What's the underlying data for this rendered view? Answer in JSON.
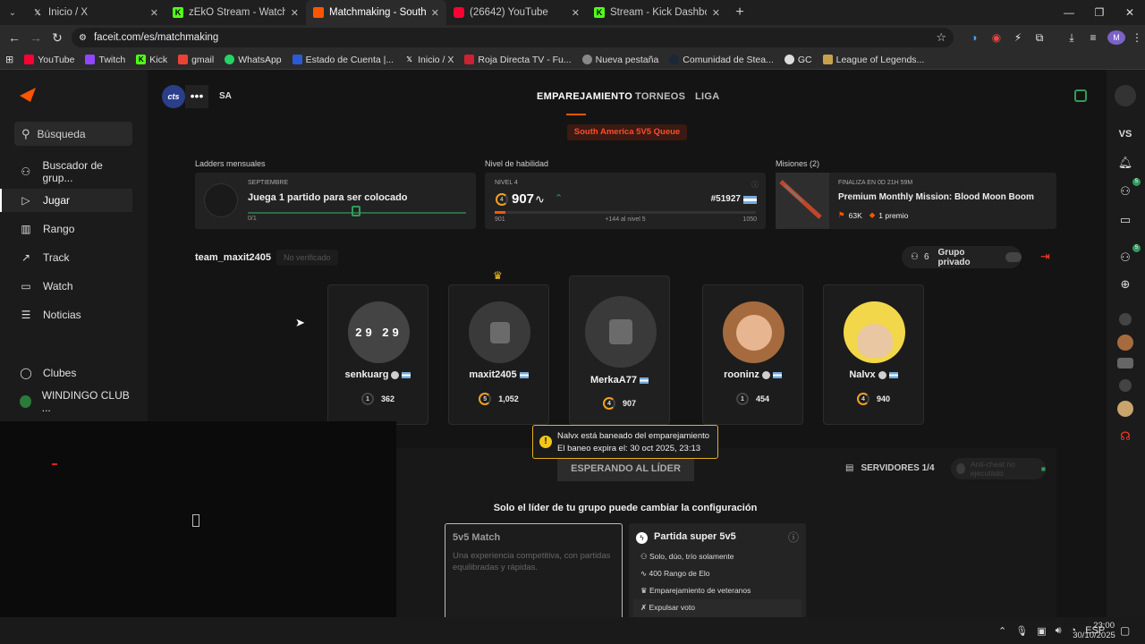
{
  "browser": {
    "tabs": [
      {
        "title": "Inicio / X",
        "icon": "x-icon",
        "active": false
      },
      {
        "title": "zEkO Stream - Watch Live on Ki",
        "icon": "kick-icon",
        "active": false
      },
      {
        "title": "Matchmaking - South America",
        "icon": "faceit-icon",
        "active": true
      },
      {
        "title": "(26642) YouTube",
        "icon": "youtube-icon",
        "active": false
      },
      {
        "title": "Stream - Kick Dashboard",
        "icon": "kick-icon",
        "active": false
      }
    ],
    "url": "faceit.com/es/matchmaking",
    "bookmarks": [
      "YouTube",
      "Twitch",
      "Kick",
      "gmail",
      "WhatsApp",
      "Estado de Cuenta |...",
      "Inicio / X",
      "Roja Directa TV - Fu...",
      "Nueva pestaña",
      "Comunidad de Stea...",
      "GC",
      "League of Legends..."
    ],
    "profile_initial": "M"
  },
  "sidebar": {
    "search_placeholder": "Búsqueda",
    "items": [
      {
        "label": "Buscador de grup...",
        "icon": "group-search-icon"
      },
      {
        "label": "Jugar",
        "icon": "play-icon",
        "active": true
      },
      {
        "label": "Rango",
        "icon": "ranking-icon"
      },
      {
        "label": "Track",
        "icon": "track-icon"
      },
      {
        "label": "Watch",
        "icon": "watch-icon"
      },
      {
        "label": "Noticias",
        "icon": "news-icon"
      },
      {
        "label": "Clubes",
        "icon": "clubs-icon"
      },
      {
        "label": "WINDINGO CLUB ...",
        "icon": "club-avatar-icon"
      }
    ]
  },
  "header": {
    "team_badge": "cts",
    "region": "SA",
    "nav": [
      "EMPAREJAMIENTO",
      "TORNEOS",
      "LIGA"
    ],
    "queue": "South America 5V5 Queue"
  },
  "ladders": {
    "title": "Ladders mensuales",
    "month": "SEPTIEMBRE",
    "task": "Juega 1 partido para ser colocado",
    "progress_label": "0/1",
    "progress": 0.0
  },
  "skill": {
    "title": "Nivel de habilidad",
    "level_label": "NIVEL 4",
    "elo": "907",
    "rank": "#51927",
    "min": "901",
    "max": "1050",
    "to_next": "+144 al nivel 5",
    "progress": 0.04
  },
  "missions": {
    "title": "Misiones (2)",
    "ends": "FINALIZA EN 0D 21H 59M",
    "name": "Premium Monthly Mission: Blood Moon Boom",
    "points": "63K",
    "reward": "1 premio"
  },
  "party": {
    "name": "team_maxit2405",
    "status": "No verificado",
    "count": "6",
    "private_label": "Grupo privado"
  },
  "players": [
    {
      "name": "senkuarg",
      "level": "1",
      "elo": "362",
      "avatar": "29 29",
      "leader": false
    },
    {
      "name": "maxit2405",
      "level": "5",
      "elo": "1,052",
      "avatar": "",
      "leader": true
    },
    {
      "name": "MerkaA77",
      "level": "4",
      "elo": "907",
      "avatar": "",
      "leader": false
    },
    {
      "name": "rooninz",
      "level": "1",
      "elo": "454",
      "avatar": "",
      "leader": false
    },
    {
      "name": "Nalvx",
      "level": "4",
      "elo": "940",
      "avatar": "",
      "leader": false
    }
  ],
  "ban_notice": {
    "line1": "Nalvx está baneado del emparejamiento",
    "line2": "El baneo expira el: 30 oct 2025, 23:13"
  },
  "actions": {
    "waiting": "ESPERANDO AL LÍDER",
    "servers": "SERVIDORES 1/4",
    "anticheat": "Anti-cheat no ejecutado"
  },
  "config": {
    "note": "Solo el líder de tu grupo puede cambiar la configuración",
    "match_title": "5v5 Match",
    "match_desc": "Una experiencia competitiva, con partidas equilibradas y rápidas.",
    "super_title": "Partida super 5v5",
    "super_features": [
      "Solo, dúo, trío solamente",
      "400 Rango de Elo",
      "Emparejamiento de veteranos",
      "Expulsar voto"
    ]
  },
  "rightbar": {
    "vs": "VS",
    "badge1": "5",
    "badge2": "5"
  },
  "taskbar": {
    "lang": "ESP",
    "time": "23:00",
    "date": "30/10/2025"
  },
  "colors": {
    "accent": "#ff5500",
    "queue_red": "#ff3d1f",
    "green": "#2f9c5a",
    "warning": "#f5c518"
  }
}
